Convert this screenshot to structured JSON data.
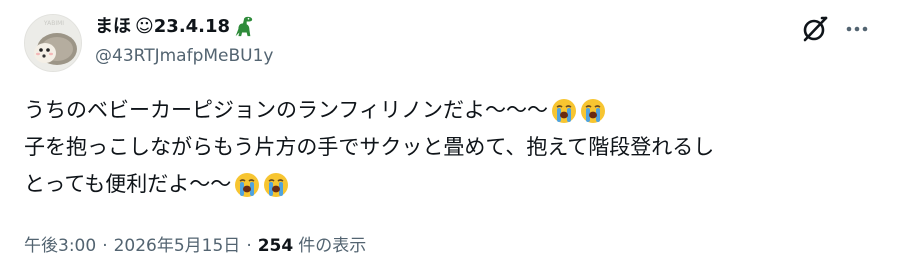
{
  "tweet": {
    "author": {
      "display_name": "まほ",
      "name_suffix": "☺23.4.18",
      "handle": "@43RTJmafpMeBU1y",
      "avatar_icon": "hedgehog-avatar",
      "suffix_icon": "dinosaur-icon"
    },
    "lines": [
      {
        "text": "うちのベビーカーピジョンのランフィリノンだよ〜〜〜",
        "emoji": [
          "loudly-crying-face",
          "loudly-crying-face"
        ]
      },
      {
        "text": "子を抱っこしながらもう片方の手でサクッと畳めて、抱えて階段登れるし",
        "emoji": []
      },
      {
        "text": "とっても便利だよ〜〜",
        "emoji": [
          "loudly-crying-face",
          "loudly-crying-face"
        ]
      }
    ],
    "meta": {
      "time": "午後3:00",
      "separator": "·",
      "date": "2026年5月15日",
      "view_count": "254",
      "view_label": "件の表示"
    },
    "actions": {
      "grok_icon": "grok-icon",
      "more_icon": "more-icon"
    }
  },
  "colors": {
    "text": "#0f1419",
    "secondary": "#536471",
    "dino": "#2e8b3a",
    "emoji_face": "#f7c531",
    "emoji_tears": "#4fa3e0"
  }
}
